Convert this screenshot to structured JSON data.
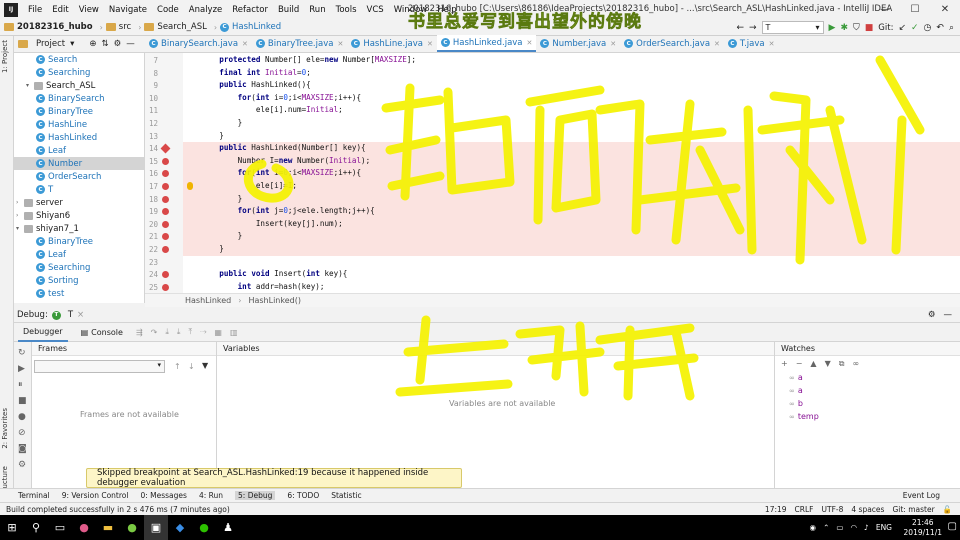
{
  "menubar": {
    "items": [
      "File",
      "Edit",
      "View",
      "Navigate",
      "Code",
      "Analyze",
      "Refactor",
      "Build",
      "Run",
      "Tools",
      "VCS",
      "Window",
      "Help"
    ],
    "title": "20182316_hubo [C:\\Users\\86186\\IdeaProjects\\20182316_hubo] - ...\\src\\Search_ASL\\HashLinked.java - IntelliJ IDEA"
  },
  "navbar": {
    "project": "20182316_hubo",
    "src": "src",
    "package": "Search_ASL",
    "file": "HashLinked",
    "run_config": "T",
    "git_label": "Git:"
  },
  "overlay_text": "书里总爱写到喜出望外的傍晚",
  "left_tools": {
    "project": "1: Project",
    "favorites": "2: Favorites",
    "structure": "Z: Structure"
  },
  "project_panel": {
    "title": "Project",
    "tree": [
      {
        "label": "Search",
        "depth": 2,
        "kind": "class"
      },
      {
        "label": "Searching",
        "depth": 2,
        "kind": "class"
      },
      {
        "label": "Search_ASL",
        "depth": 1,
        "kind": "package",
        "open": true
      },
      {
        "label": "BinarySearch",
        "depth": 2,
        "kind": "class"
      },
      {
        "label": "BinaryTree",
        "depth": 2,
        "kind": "class"
      },
      {
        "label": "HashLine",
        "depth": 2,
        "kind": "class"
      },
      {
        "label": "HashLinked",
        "depth": 2,
        "kind": "class"
      },
      {
        "label": "Leaf",
        "depth": 2,
        "kind": "class"
      },
      {
        "label": "Number",
        "depth": 2,
        "kind": "class",
        "selected": true
      },
      {
        "label": "OrderSearch",
        "depth": 2,
        "kind": "class"
      },
      {
        "label": "T",
        "depth": 2,
        "kind": "class"
      },
      {
        "label": "server",
        "depth": 0,
        "kind": "package"
      },
      {
        "label": "Shiyan6",
        "depth": 0,
        "kind": "package"
      },
      {
        "label": "shiyan7_1",
        "depth": 0,
        "kind": "package",
        "open": true
      },
      {
        "label": "BinaryTree",
        "depth": 2,
        "kind": "class"
      },
      {
        "label": "Leaf",
        "depth": 2,
        "kind": "class"
      },
      {
        "label": "Searching",
        "depth": 2,
        "kind": "class"
      },
      {
        "label": "Sorting",
        "depth": 2,
        "kind": "class"
      },
      {
        "label": "test",
        "depth": 2,
        "kind": "class"
      }
    ]
  },
  "editor_tabs": [
    {
      "label": "BinarySearch.java"
    },
    {
      "label": "BinaryTree.java"
    },
    {
      "label": "HashLine.java"
    },
    {
      "label": "HashLinked.java",
      "active": true
    },
    {
      "label": "Number.java"
    },
    {
      "label": "OrderSearch.java"
    },
    {
      "label": "T.java"
    }
  ],
  "code_lines": [
    {
      "n": "7",
      "text": "    protected Number[] ele=new Number[MAXSIZE];"
    },
    {
      "n": "8",
      "text": "    final int Initial=0;"
    },
    {
      "n": "9",
      "text": "    public HashLinked(){"
    },
    {
      "n": "10",
      "text": "        for(int i=0;i<MAXSIZE;i++){"
    },
    {
      "n": "11",
      "text": "            ele[i].num=Initial;"
    },
    {
      "n": "12",
      "text": "        }"
    },
    {
      "n": "13",
      "text": "    }"
    },
    {
      "n": "14",
      "text": "    public HashLinked(Number[] key){",
      "hl": true,
      "bp": "diamond"
    },
    {
      "n": "15",
      "text": "        Number I=new Number(Initial);",
      "hl": true,
      "bp": "dot"
    },
    {
      "n": "16",
      "text": "        for(int i=0;i<MAXSIZE;i++){",
      "hl": true,
      "bp": "dot"
    },
    {
      "n": "17",
      "text": "            ele[i]=I;",
      "hl": true,
      "bp": "dot"
    },
    {
      "n": "18",
      "text": "        }",
      "hl": true,
      "bp": "dot"
    },
    {
      "n": "19",
      "text": "        for(int j=0;j<ele.length;j++){",
      "hl": true,
      "bp": "dot"
    },
    {
      "n": "20",
      "text": "            Insert(key[j].num);",
      "hl": true,
      "bp": "dot"
    },
    {
      "n": "21",
      "text": "        }",
      "hl": true,
      "bp": "dot"
    },
    {
      "n": "22",
      "text": "    }",
      "hl": true,
      "bp": "dot"
    },
    {
      "n": "23",
      "text": ""
    },
    {
      "n": "24",
      "text": "    public void Insert(int key){",
      "bp": "dot"
    },
    {
      "n": "25",
      "text": "        int addr=hash(key);",
      "bp": "dot"
    }
  ],
  "breadcrumb": {
    "cls": "HashLinked",
    "method": "HashLinked()"
  },
  "debug": {
    "label": "Debug:",
    "config": "T",
    "tabs": {
      "debugger": "Debugger",
      "console": "Console"
    },
    "frames_title": "Frames",
    "frames_empty": "Frames are not available",
    "variables_title": "Variables",
    "variables_empty": "Variables are not available",
    "watches_title": "Watches",
    "watches": [
      "a",
      "a",
      "b",
      "temp"
    ]
  },
  "toast": "Skipped breakpoint at Search_ASL.HashLinked:19 because it happened inside debugger evaluation",
  "bottom_tools": [
    {
      "label": "Terminal"
    },
    {
      "label": "9: Version Control"
    },
    {
      "label": "0: Messages"
    },
    {
      "label": "4: Run"
    },
    {
      "label": "5: Debug",
      "active": true
    },
    {
      "label": "6: TODO"
    },
    {
      "label": "Statistic"
    }
  ],
  "event_log": "Event Log",
  "status": {
    "message": "Build completed successfully in 2 s 476 ms (7 minutes ago)",
    "position": "17:19",
    "line_sep": "CRLF",
    "encoding": "UTF-8",
    "indent": "4 spaces",
    "git": "Git: master"
  },
  "taskbar": {
    "lang": "ENG",
    "time": "21:46",
    "date": "2019/11/1"
  }
}
